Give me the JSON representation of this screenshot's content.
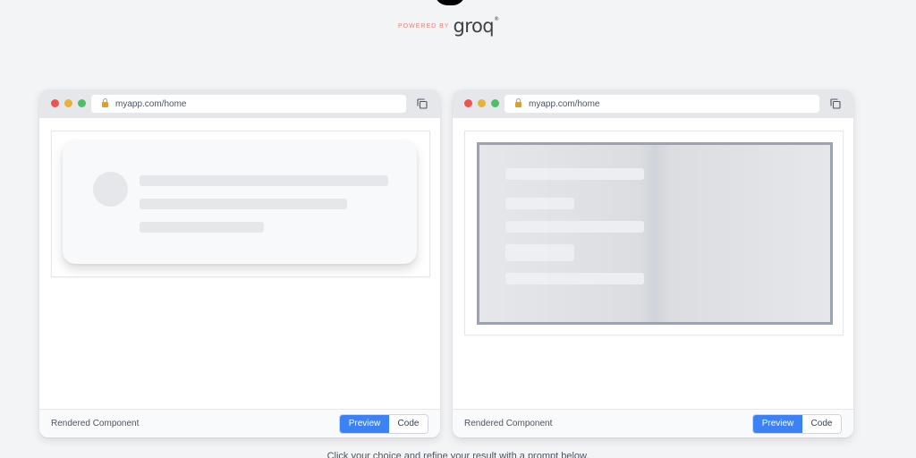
{
  "branding": {
    "powered_by": "POWERED BY",
    "logo_text": "groq",
    "logo_mark": "®"
  },
  "panels": [
    {
      "url": "myapp.com/home",
      "footer_label": "Rendered Component",
      "preview_label": "Preview",
      "code_label": "Code"
    },
    {
      "url": "myapp.com/home",
      "footer_label": "Rendered Component",
      "preview_label": "Preview",
      "code_label": "Code"
    }
  ],
  "hint": "Click your choice and refine your result with a prompt below."
}
